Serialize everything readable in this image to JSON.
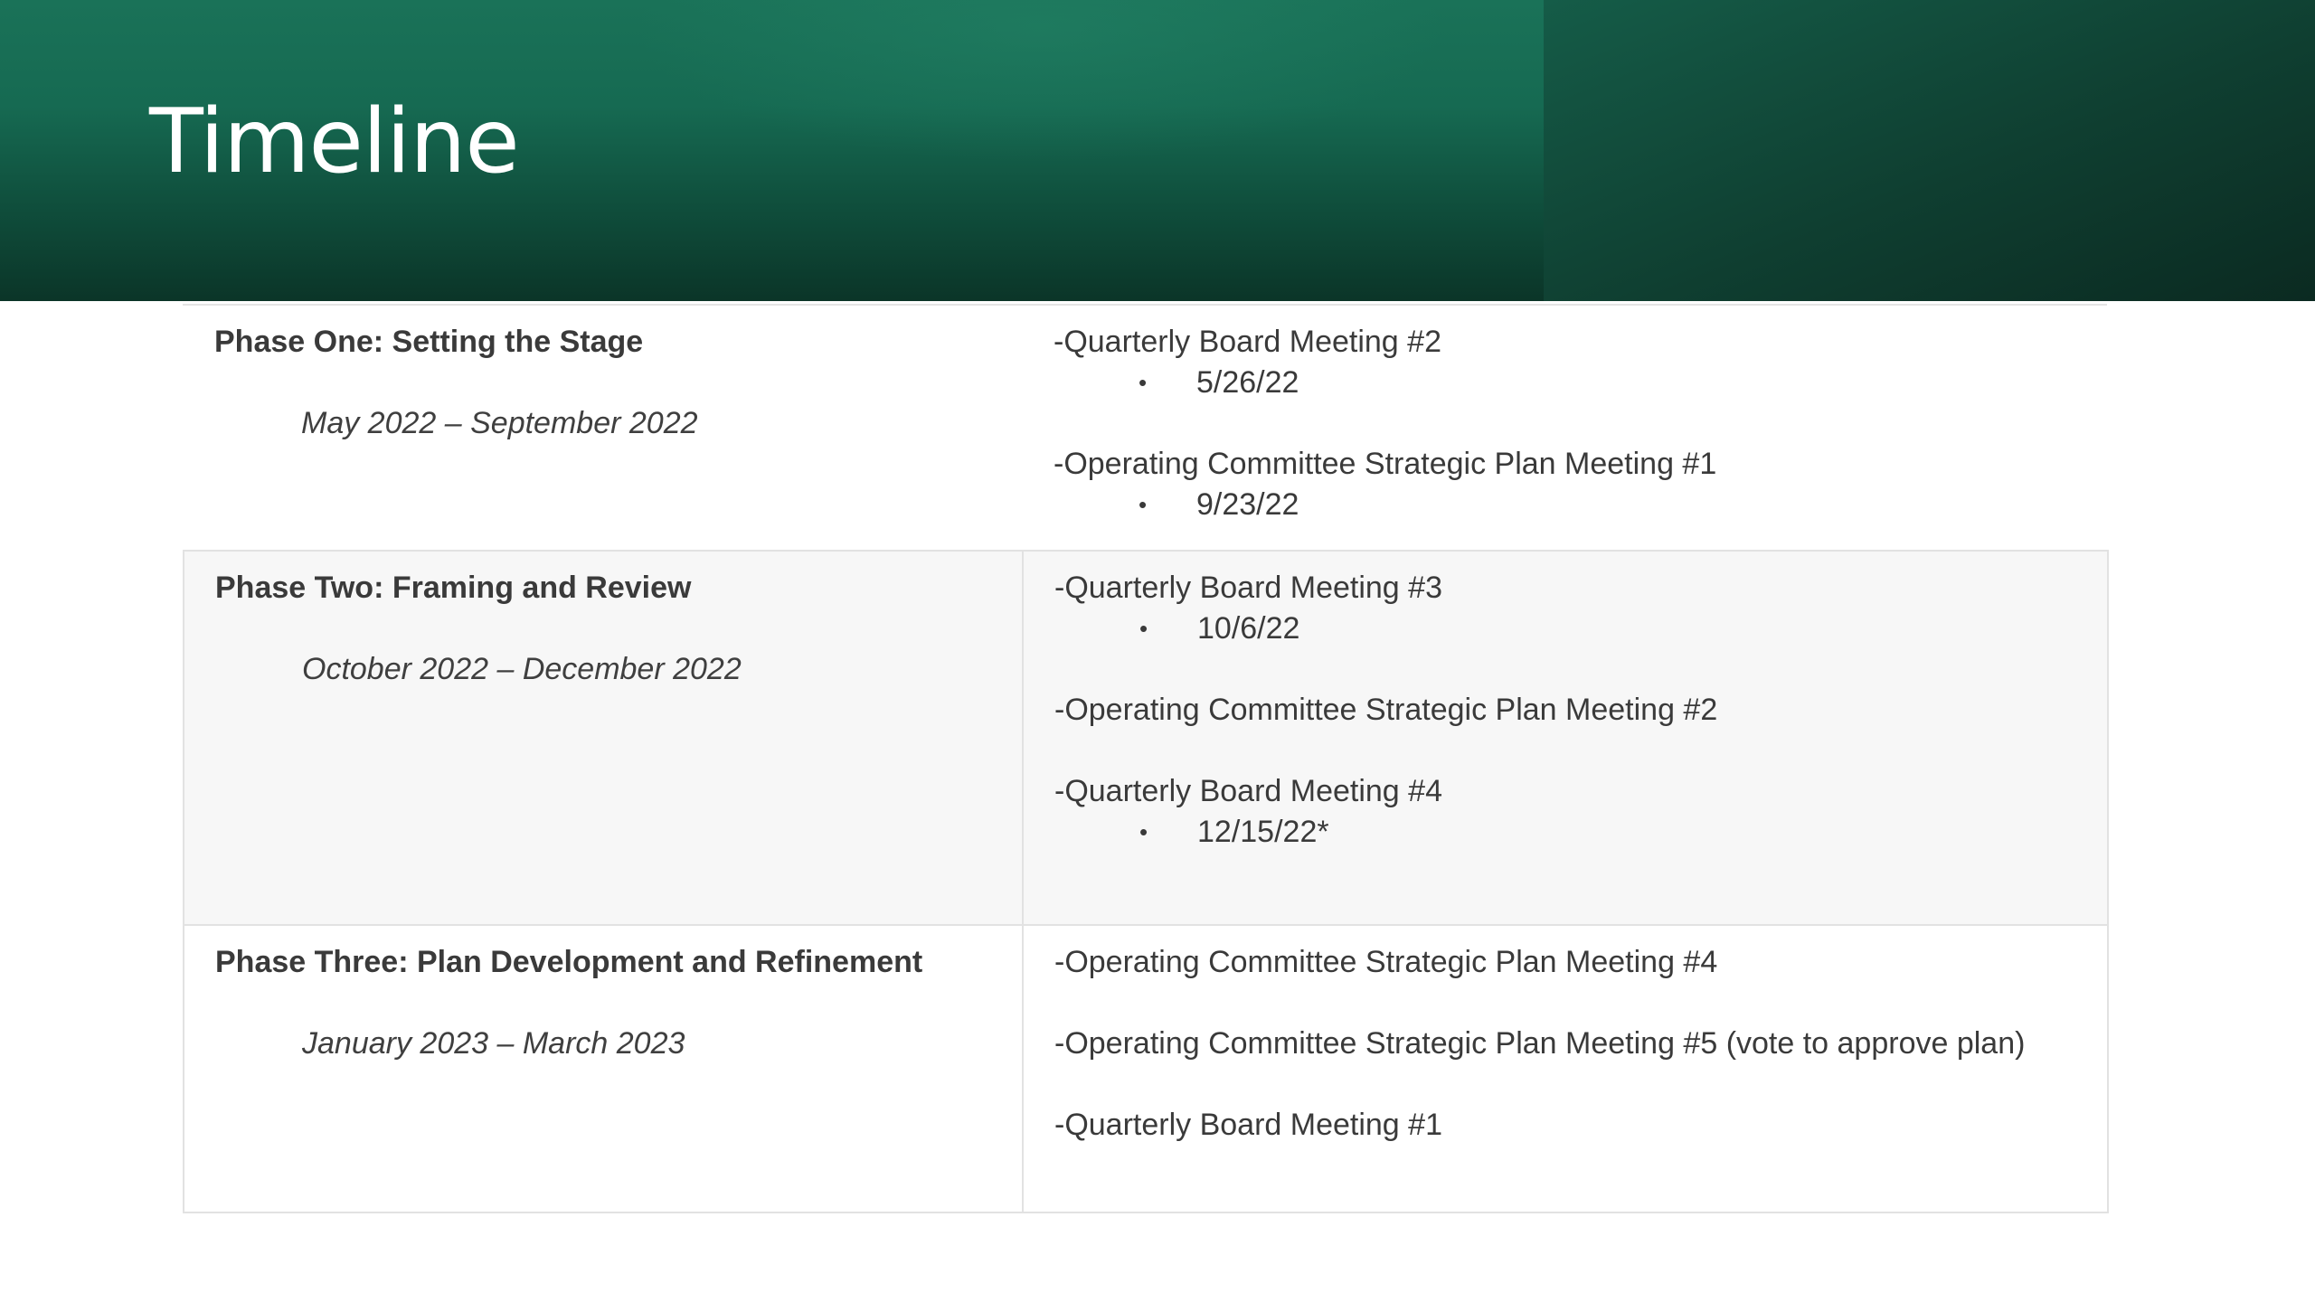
{
  "slide": {
    "title": "Timeline"
  },
  "colors": {
    "banner_top": "#1a7258",
    "banner_bottom": "#0b3528",
    "banner_right": "#0f3f31",
    "text": "#3a3a3a",
    "row_shade": "#f7f7f7",
    "border": "#e2e2e2"
  },
  "phases": [
    {
      "name": "Phase One: Setting the Stage",
      "dates": "May 2022 – September 2022",
      "events": [
        {
          "title": "-Quarterly Board Meeting #2",
          "date": "5/26/22"
        },
        {
          "title": "-Operating Committee Strategic Plan Meeting #1",
          "date": "9/23/22"
        }
      ]
    },
    {
      "name": "Phase Two: Framing and Review",
      "dates": "October 2022 – December 2022",
      "events": [
        {
          "title": "-Quarterly Board Meeting #3",
          "date": "10/6/22"
        },
        {
          "title": "-Operating Committee Strategic Plan Meeting #2"
        },
        {
          "title": "-Quarterly Board Meeting #4",
          "date": "12/15/22*"
        }
      ]
    },
    {
      "name": "Phase Three: Plan Development and Refinement",
      "dates": "January 2023 – March 2023",
      "events": [
        {
          "title": "-Operating Committee Strategic Plan Meeting #4"
        },
        {
          "title": "-Operating Committee Strategic Plan Meeting #5 (vote to approve plan)"
        },
        {
          "title": "-Quarterly Board Meeting #1"
        }
      ]
    }
  ],
  "bullet_glyph": "•"
}
